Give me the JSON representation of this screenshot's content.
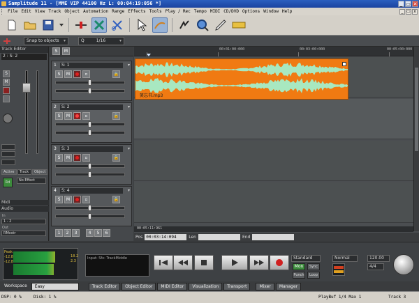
{
  "window": {
    "title": "Samplitude 11 - [MME VIP   44100 Hz L: 00:04:19:056 *]",
    "controls": [
      "_",
      "▭",
      "✕"
    ]
  },
  "menubar": {
    "items": [
      "File",
      "Edit",
      "View",
      "Track",
      "Object",
      "Automation",
      "Range",
      "Effects",
      "Tools",
      "Play / Rec",
      "Tempo",
      "MIDI",
      "CD/DVD",
      "Options",
      "Window",
      "Help"
    ],
    "mdi_controls": [
      "_",
      "▭",
      "x"
    ]
  },
  "toolbar": {
    "icons": [
      "new-project-icon",
      "open-project-icon",
      "save-project-icon",
      "save-dropdown-icon",
      "cut-icon",
      "split-icon",
      "scissors-icon",
      "pointer-tool-icon",
      "curve-tool-icon",
      "scrub-tool-icon",
      "zoom-tool-icon",
      "draw-tool-icon",
      "eraser-tool-icon"
    ]
  },
  "secbar": {
    "snap_label": "Snap to objects",
    "grid_label": "1/16",
    "grid_q": "Q"
  },
  "track_editor": {
    "header": "Track Editor",
    "track_name": "2 : S: 2",
    "buttons": [
      "S",
      "M"
    ],
    "mode_label": "Rd",
    "fx_label": "No Effect",
    "tabs": [
      "Active",
      "Track",
      "Object"
    ],
    "sections": [
      "Midi",
      "Audio"
    ],
    "in_label": "In",
    "in_value": "1 - 2",
    "out_label": "Out",
    "out_value": "RMxstr"
  },
  "tracks": [
    {
      "num": "1",
      "name": "S: 1",
      "selected": false,
      "rec_armed": false
    },
    {
      "num": "2",
      "name": "S: 2",
      "selected": true,
      "rec_armed": true
    },
    {
      "num": "3",
      "name": "S: 3",
      "selected": false,
      "rec_armed": false
    },
    {
      "num": "4",
      "name": "S: 4",
      "selected": false,
      "rec_armed": false
    }
  ],
  "track_header_bar": {
    "s": "S",
    "m": "M"
  },
  "groups": {
    "numbers": [
      "1",
      "2",
      "3",
      "4",
      "5",
      "6"
    ]
  },
  "ruler": {
    "labels": [
      "00:01:00:000",
      "00:03:00:000",
      "00:05:00:000"
    ]
  },
  "clip": {
    "name": "笑忘书.mp3",
    "color": "#f07a12",
    "wave_color": "#a8e8c0"
  },
  "position": {
    "time": "00:05:11:961",
    "pos_label": "Pos",
    "pos_value": "00:03:14:094",
    "len_label": "Len",
    "end_label": "End"
  },
  "vu": {
    "scale": [
      "Peak",
      "-12.8",
      "-12.8"
    ],
    "right_scale": [
      "18.2",
      "2.3"
    ],
    "level_left": 0.75,
    "level_right": 0.72
  },
  "transport": {
    "display_text": "Input: Sfx: TrackMiddle",
    "mode_standard": "Standard",
    "mode_mon": "Mon",
    "mode_sync": "Sync",
    "punch": "Punch",
    "loop": "Loop",
    "normal": "Normal",
    "bpm": "120.00",
    "signature": "4/4",
    "transport_icons": [
      "skip-back-icon",
      "rewind-icon",
      "stop-icon",
      "play-icon",
      "fast-forward-icon",
      "record-icon"
    ]
  },
  "bottom_tabs": {
    "workspace_label": "Workspace",
    "workspace_value": "Easy",
    "tabs": [
      "Track Editor",
      "Object Editor",
      "MIDI Editor",
      "Visualization",
      "Transport",
      "Mixer",
      "Manager"
    ]
  },
  "statusbar": {
    "dsp": "DSP: 0 %",
    "disk": "Disk: 1 %",
    "playbuf": "PlayBuf 1/4  Max 1",
    "track": "Track 3"
  }
}
